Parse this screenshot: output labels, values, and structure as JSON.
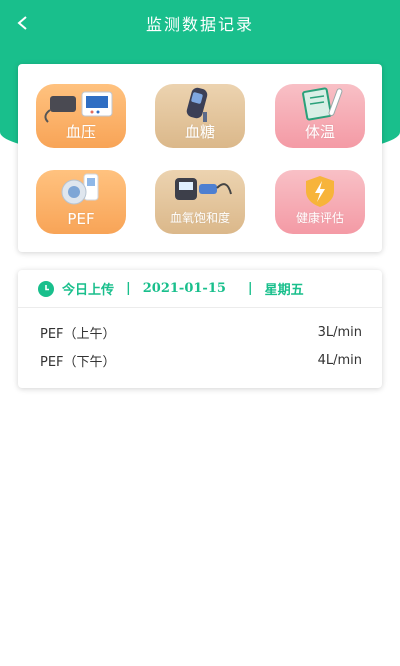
{
  "header": {
    "title": "监测数据记录"
  },
  "colors": {
    "brand": "#19bf8c",
    "orange_tile": "#f8a457",
    "beige_tile": "#dbb88a",
    "pink_tile": "#f49aa5"
  },
  "tiles": [
    {
      "label": "血压",
      "icon": "blood-pressure-monitor-icon"
    },
    {
      "label": "血糖",
      "icon": "glucose-meter-icon"
    },
    {
      "label": "体温",
      "icon": "thermometer-icon"
    },
    {
      "label": "PEF",
      "icon": "peak-flow-meter-icon"
    },
    {
      "label": "血氧饱和度",
      "icon": "pulse-oximeter-icon"
    },
    {
      "label": "健康评估",
      "icon": "shield-lightning-icon"
    }
  ],
  "records": {
    "today_label": "今日上传",
    "date": "2021-01-15",
    "weekday": "星期五",
    "rows": [
      {
        "name": "PEF（上午）",
        "value": "3L/min"
      },
      {
        "name": "PEF（下午）",
        "value": "4L/min"
      }
    ]
  }
}
